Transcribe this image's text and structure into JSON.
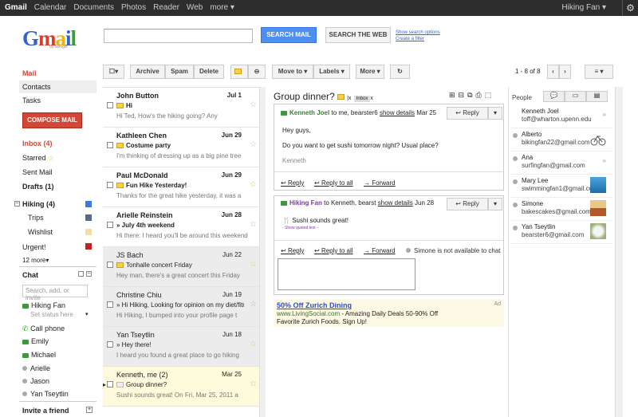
{
  "topbar": {
    "items": [
      "Gmail",
      "Calendar",
      "Documents",
      "Photos",
      "Reader",
      "Web",
      "more ▾"
    ],
    "user": "Hiking Fan ▾"
  },
  "header": {
    "logo": "Gmail",
    "logo_sub": "by Google",
    "search_mail": "SEARCH MAIL",
    "search_web": "SEARCH THE WEB",
    "opt1": "Show search options",
    "opt2": "Create a filter"
  },
  "nav": {
    "mail": "Mail",
    "contacts": "Contacts",
    "tasks": "Tasks",
    "compose": "COMPOSE MAIL",
    "inbox": "Inbox (4)",
    "starred": "Starred",
    "sent": "Sent Mail",
    "drafts": "Drafts (1)",
    "hiking": "Hiking (4)",
    "trips": "Trips",
    "wishlist": "Wishlist",
    "urgent": "Urgent!",
    "more": "12 more▾"
  },
  "chat": {
    "title": "Chat",
    "placeholder": "Search, add, or invite",
    "me": "Hiking Fan",
    "status": "Set status here",
    "call": "Call phone",
    "contacts": [
      "Emily",
      "Michael",
      "Arielle",
      "Jason",
      "Yan Tseytlin"
    ],
    "invite": "Invite a friend"
  },
  "toolbar": {
    "archive": "Archive",
    "spam": "Spam",
    "delete": "Delete",
    "move": "Move to ▾",
    "labels": "Labels ▾",
    "more": "More ▾",
    "count": "1 - 8 of 8"
  },
  "emails": [
    {
      "from": "John Button",
      "date": "Jul 1",
      "subject": "Hi",
      "snippet": "Hi Ted, How's the hiking going? Any",
      "state": "unread"
    },
    {
      "from": "Kathleen Chen",
      "date": "Jun 29",
      "subject": "Costume party",
      "snippet": "I'm thinking of dressing up as a big pine tree",
      "state": "unread"
    },
    {
      "from": "Paul McDonald",
      "date": "Jun 29",
      "subject": "Fun Hike Yesterday!",
      "snippet": "Thanks for the great hike yesterday, it was a",
      "state": "unread"
    },
    {
      "from": "Arielle Reinstein",
      "date": "Jun 28",
      "subject": "» July 4th weekend",
      "snippet": "Hi there: I heard you'll be around this weekend",
      "state": "unread"
    },
    {
      "from": "JS Bach",
      "date": "Jun 22",
      "subject": "Tonhalle concert Friday",
      "snippet": "Hey man, there's a great concert this Friday",
      "state": "read"
    },
    {
      "from": "Christine Chiu",
      "date": "Jun 19",
      "subject": "» Hi Hiking, Looking for opinion on my diet/fitness",
      "snippet": "Hi Hiking, I bumped into your profile page t",
      "state": "read"
    },
    {
      "from": "Yan Tseytlin",
      "date": "Jun 18",
      "subject": "» Hey there!",
      "snippet": "I heard you found a great place to go hiking",
      "state": "read"
    },
    {
      "from": "Kenneth, me (2)",
      "date": "Mar 25",
      "subject": "Group dinner?",
      "snippet": "Sushi sounds great! On Fri, Mar 25, 2011 a",
      "state": "sel"
    }
  ],
  "conversation": {
    "title": "Group dinner?",
    "label": "Inbox",
    "m1_from": "Kenneth Joel",
    "m1_to": "to me, bearster6",
    "m1_details": "show details",
    "m1_date": "Mar 25",
    "m1_body1": "Hey guys,",
    "m1_body2": "Do you want to get sushi tomorrow night?  Usual place?",
    "m1_sig": "Kenneth",
    "reply": "Reply",
    "reply_all": "Reply to all",
    "forward": "Forward",
    "m2_from": "Hiking Fan",
    "m2_to": "to Kenneth, bearst",
    "m2_date": "Jun 28",
    "m2_body": "Sushi sounds great!",
    "m2_quoted": "- Show quoted text -",
    "unavailable": "Simone is not available to chat"
  },
  "ad": {
    "title": "50% Off Zurich Dining",
    "url": "www.LivingSocial.com",
    "line1": " - Amazing Daily Deals 50-90% Off",
    "line2": "Favorite Zurich Foods. Sign Up!",
    "tag": "Ad"
  },
  "people": {
    "title": "People",
    "list": [
      {
        "name": "Kenneth Joel",
        "email": "toff@wharton.upenn.edu"
      },
      {
        "name": "Alberto",
        "email": "bikingfan22@gmail.com"
      },
      {
        "name": "Ana",
        "email": "surfingfan@gmail.com"
      },
      {
        "name": "Mary Lee",
        "email": "swimmingfan1@gmail.com"
      },
      {
        "name": "Simone",
        "email": "bakescakes@gmail.com"
      },
      {
        "name": "Yan Tseytlin",
        "email": "bearster6@gmail.com"
      }
    ]
  }
}
